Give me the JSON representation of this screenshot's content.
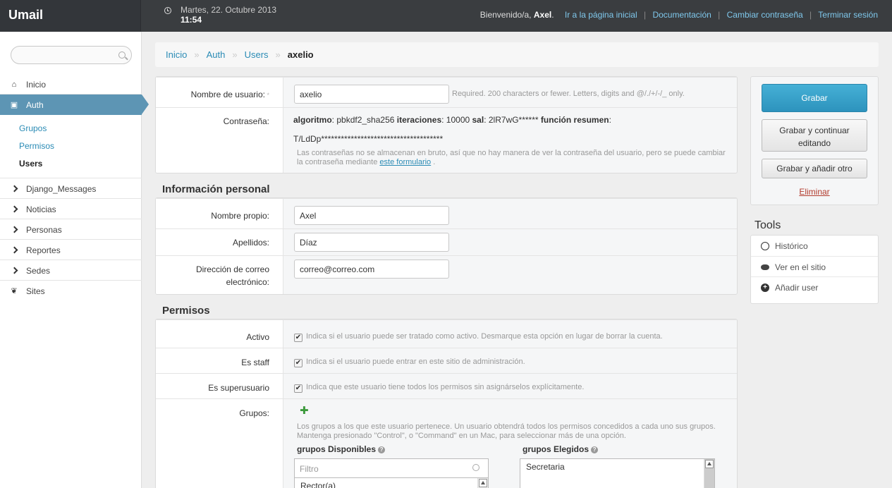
{
  "header": {
    "brand": "Umail",
    "date": "Martes, 22. Octubre 2013",
    "time": "11:54",
    "welcome": "Bienvenido/a,",
    "username": "Axel",
    "links": [
      "Ir a la página inicial",
      "Documentación",
      "Cambiar contraseña",
      "Terminar sesión"
    ]
  },
  "sidebar": {
    "search_placeholder": "",
    "items": [
      {
        "label": "Inicio",
        "icon": "home-icon"
      },
      {
        "label": "Auth",
        "icon": "lock-icon"
      },
      {
        "label": "Django_Messages",
        "icon": "chevron-right-icon"
      },
      {
        "label": "Noticias",
        "icon": "chevron-right-icon"
      },
      {
        "label": "Personas",
        "icon": "chevron-right-icon"
      },
      {
        "label": "Reportes",
        "icon": "chevron-right-icon"
      },
      {
        "label": "Sedes",
        "icon": "chevron-right-icon"
      },
      {
        "label": "Sites",
        "icon": "leaf-icon"
      }
    ],
    "sub_items": [
      "Grupos",
      "Permisos",
      "Users"
    ]
  },
  "breadcrumb": [
    "Inicio",
    "Auth",
    "Users",
    "axelio"
  ],
  "user_panel": {
    "username_label": "Nombre de usuario:",
    "username_value": "axelio",
    "username_help": "Required. 200 characters or fewer. Letters, digits and @/./+/-/_ only.",
    "password_label": "Contraseña:",
    "pw_algo_label": "algoritmo",
    "pw_algo_value": ": pbkdf2_sha256 ",
    "pw_iter_label": "iteraciones",
    "pw_iter_value": ": 10000 ",
    "pw_salt_label": "sal",
    "pw_salt_value": ": 2lR7wG****** ",
    "pw_hash_label": "función resumen",
    "pw_hash_value": ":",
    "pw_hash_line2": "T/LdDp*************************************",
    "pw_help_1": "Las contraseñas no se almacenan en bruto, así que no hay manera de ver la contraseña del usuario, pero se puede cambiar",
    "pw_help_2a": "la contraseña mediante ",
    "pw_help_link": "este formulario",
    "pw_help_2b": " ."
  },
  "personal": {
    "title": "Información personal",
    "first_name_label": "Nombre propio:",
    "first_name_value": "Axel",
    "last_name_label": "Apellidos:",
    "last_name_value": "Díaz",
    "email_label_1": "Dirección de correo",
    "email_label_2": "electrónico:",
    "email_value": "correo@correo.com"
  },
  "permissions": {
    "title": "Permisos",
    "active_label": "Activo",
    "active_help": "Indica si el usuario puede ser tratado como activo. Desmarque esta opción en lugar de borrar la cuenta.",
    "staff_label": "Es staff",
    "staff_help": "Indica si el usuario puede entrar en este sitio de administración.",
    "superuser_label": "Es superusuario",
    "superuser_help": "Indica que este usuario tiene todos los permisos sin asignárselos explícitamente.",
    "groups_label": "Grupos:",
    "groups_help_1": "Los grupos a los que este usuario pertenece. Un usuario obtendrá todos los permisos concedidos a cada uno sus grupos.",
    "groups_help_2": "Mantenga presionado \"Control\", o \"Command\" en un Mac, para seleccionar más de una opción.",
    "available_title": "grupos Disponibles",
    "filter_placeholder": "Filtro",
    "available_items": [
      "Rector(a)"
    ],
    "chosen_title": "grupos Elegidos",
    "chosen_items": [
      "Secretaria"
    ]
  },
  "submit": {
    "save": "Grabar",
    "save_continue_1": "Grabar y continuar",
    "save_continue_2": "editando",
    "save_add": "Grabar y añadir otro",
    "delete": "Eliminar"
  },
  "tools": {
    "title": "Tools",
    "items": [
      {
        "label": "Histórico",
        "icon": "clock-icon"
      },
      {
        "label": "Ver en el sitio",
        "icon": "eye-icon"
      },
      {
        "label": "Añadir user",
        "icon": "plus-circle-icon"
      }
    ]
  }
}
